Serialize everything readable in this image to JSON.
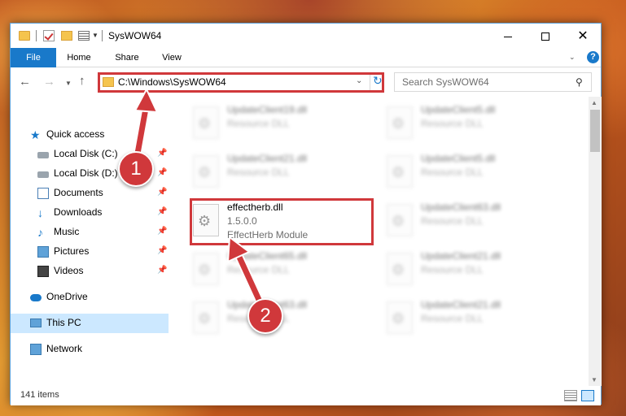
{
  "window": {
    "title": "SysWOW64"
  },
  "ribbon": {
    "tabs": [
      "File",
      "Home",
      "Share",
      "View"
    ],
    "help": "?"
  },
  "address": {
    "path": "C:\\Windows\\SysWOW64",
    "search_placeholder": "Search SysWOW64"
  },
  "sidebar": {
    "items": [
      {
        "label": "Quick access",
        "icon": "star-icon"
      },
      {
        "label": "Local Disk (C:)",
        "icon": "disk-icon",
        "pinned": true
      },
      {
        "label": "Local Disk (D:)",
        "icon": "disk-icon",
        "pinned": true
      },
      {
        "label": "Documents",
        "icon": "document-icon",
        "pinned": true
      },
      {
        "label": "Downloads",
        "icon": "download-icon",
        "pinned": true
      },
      {
        "label": "Music",
        "icon": "music-icon",
        "pinned": true
      },
      {
        "label": "Pictures",
        "icon": "pictures-icon",
        "pinned": true
      },
      {
        "label": "Videos",
        "icon": "videos-icon",
        "pinned": true
      },
      {
        "label": "OneDrive",
        "icon": "cloud-icon"
      },
      {
        "label": "This PC",
        "icon": "computer-icon",
        "selected": true
      },
      {
        "label": "Network",
        "icon": "network-icon"
      }
    ]
  },
  "files": [
    {
      "name": "UpdateClient19.dll",
      "line2": "Resource DLL",
      "line3": ""
    },
    {
      "name": "UpdateClient5.dll",
      "line2": "Resource DLL",
      "line3": ""
    },
    {
      "name": "UpdateClient21.dll",
      "line2": "Resource DLL",
      "line3": ""
    },
    {
      "name": "UpdateClient5.dll",
      "line2": "Resource DLL",
      "line3": ""
    },
    {
      "name": "effectherb.dll",
      "line2": "1.5.0.0",
      "line3": "EffectHerb Module"
    },
    {
      "name": "UpdateClient63.dll",
      "line2": "Resource DLL",
      "line3": ""
    },
    {
      "name": "UpdateClient65.dll",
      "line2": "Resource DLL",
      "line3": ""
    },
    {
      "name": "UpdateClient21.dll",
      "line2": "Resource DLL",
      "line3": ""
    },
    {
      "name": "UpdateClient63.dll",
      "line2": "Resource DLL",
      "line3": ""
    },
    {
      "name": "UpdateClient21.dll",
      "line2": "Resource DLL",
      "line3": ""
    }
  ],
  "status": {
    "item_count": "141 items"
  },
  "callouts": [
    "1",
    "2"
  ],
  "colors": {
    "accent": "#1979ca",
    "highlight": "#d0383b",
    "selection": "#cce8ff"
  }
}
